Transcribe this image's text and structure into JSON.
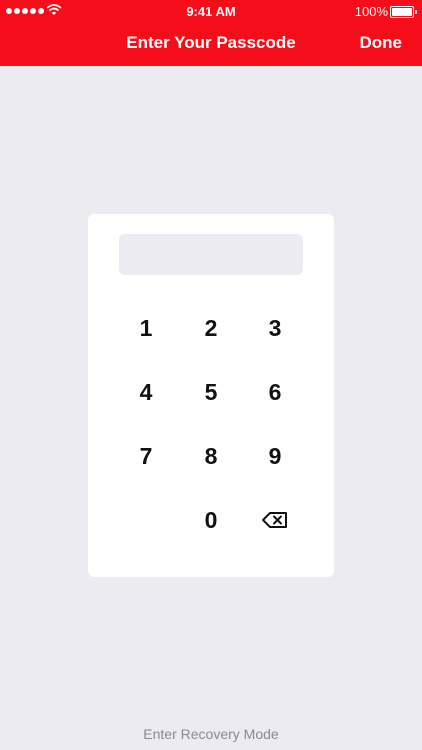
{
  "status_bar": {
    "time": "9:41 AM",
    "battery_percent": "100%",
    "battery_level": 1.0
  },
  "nav": {
    "title": "Enter Your Passcode",
    "done_label": "Done"
  },
  "keypad": {
    "keys": [
      "1",
      "2",
      "3",
      "4",
      "5",
      "6",
      "7",
      "8",
      "9",
      "0"
    ],
    "backspace_icon": "backspace-icon"
  },
  "footer": {
    "recovery_label": "Enter Recovery Mode"
  },
  "colors": {
    "accent": "#F70D1A",
    "background": "#EBEBF1",
    "card": "#FFFFFF"
  }
}
